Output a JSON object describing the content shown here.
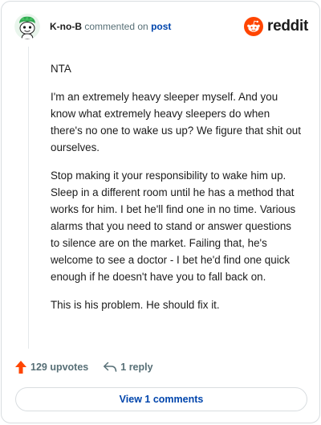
{
  "header": {
    "author": "K-no-B",
    "action_text": "commented on",
    "post_link": "post",
    "logo_text": "reddit"
  },
  "comment": {
    "paragraphs": [
      "NTA",
      "I'm an extremely heavy sleeper myself. And you know what extremely heavy sleepers do when there's no one to wake us up? We figure that shit out ourselves.",
      "Stop making it your responsibility to wake him up. Sleep in a different room until he has a method that works for him. I bet he'll find one in no time. Various alarms that you need to stand or answer questions to silence are on the market. Failing that, he's welcome to see a doctor - I bet he'd find one quick enough if he doesn't have you to fall back on.",
      "This is his problem. He should fix it."
    ]
  },
  "actions": {
    "upvotes": "129 upvotes",
    "replies": "1 reply"
  },
  "view_button": {
    "label": "View 1 comments"
  },
  "colors": {
    "brand": "#ff4500",
    "link": "#0045ac",
    "muted": "#576f76",
    "text": "#1c1c1c",
    "border": "#d9dde0"
  },
  "icons": {
    "avatar": "snoo-avatar-icon",
    "logo": "reddit-snoo-icon",
    "upvote": "arrow-up-icon",
    "reply": "reply-arrow-icon"
  }
}
